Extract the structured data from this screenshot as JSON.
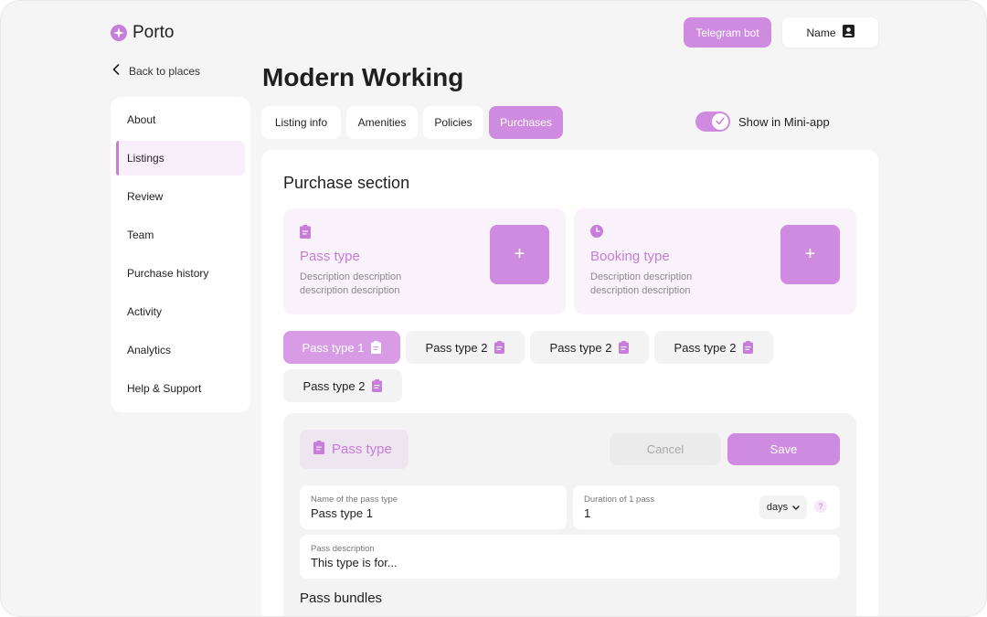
{
  "header": {
    "logo_text": "Porto",
    "telegram_label": "Telegram bot",
    "name_label": "Name"
  },
  "nav": {
    "back_label": "Back to places"
  },
  "page": {
    "title": "Modern Working"
  },
  "sidebar": {
    "items": [
      {
        "label": "About",
        "active": false
      },
      {
        "label": "Listings",
        "active": true
      },
      {
        "label": "Review",
        "active": false
      },
      {
        "label": "Team",
        "active": false
      },
      {
        "label": "Purchase history",
        "active": false
      },
      {
        "label": "Activity",
        "active": false
      },
      {
        "label": "Analytics",
        "active": false
      },
      {
        "label": "Help & Support",
        "active": false
      }
    ]
  },
  "tabs": [
    {
      "label": "Listing info",
      "active": false
    },
    {
      "label": "Amenities",
      "active": false
    },
    {
      "label": "Policies",
      "active": false
    },
    {
      "label": "Purchases",
      "active": true
    }
  ],
  "toggle": {
    "label": "Show in Mini-app",
    "checked": true
  },
  "purchase": {
    "section_title": "Purchase section",
    "cards": [
      {
        "title": "Pass type",
        "description": "Description  description description  description",
        "icon": "clipboard-icon",
        "add_label": "+"
      },
      {
        "title": "Booking type",
        "description": "Description  description description  description",
        "icon": "clock-icon",
        "add_label": "+"
      }
    ],
    "chips": [
      {
        "label": "Pass type 1",
        "active": true
      },
      {
        "label": "Pass type 2",
        "active": false
      },
      {
        "label": "Pass type 2",
        "active": false
      },
      {
        "label": "Pass type 2",
        "active": false
      },
      {
        "label": "Pass type 2",
        "active": false
      }
    ]
  },
  "editor": {
    "badge_label": "Pass type",
    "cancel_label": "Cancel",
    "save_label": "Save",
    "name_field": {
      "label": "Name of the pass type",
      "value": "Pass type 1"
    },
    "duration_field": {
      "label": "Duration of 1 pass",
      "value": "1",
      "unit": "days",
      "help": "?"
    },
    "description_field": {
      "label": "Pass description",
      "value": "This type is for..."
    },
    "bundles_title": "Pass bundles"
  },
  "colors": {
    "accent": "#cf8be0",
    "accent_text": "#c77dd9",
    "accent_soft": "#f9f2fb",
    "background": "#f5f5f5"
  }
}
